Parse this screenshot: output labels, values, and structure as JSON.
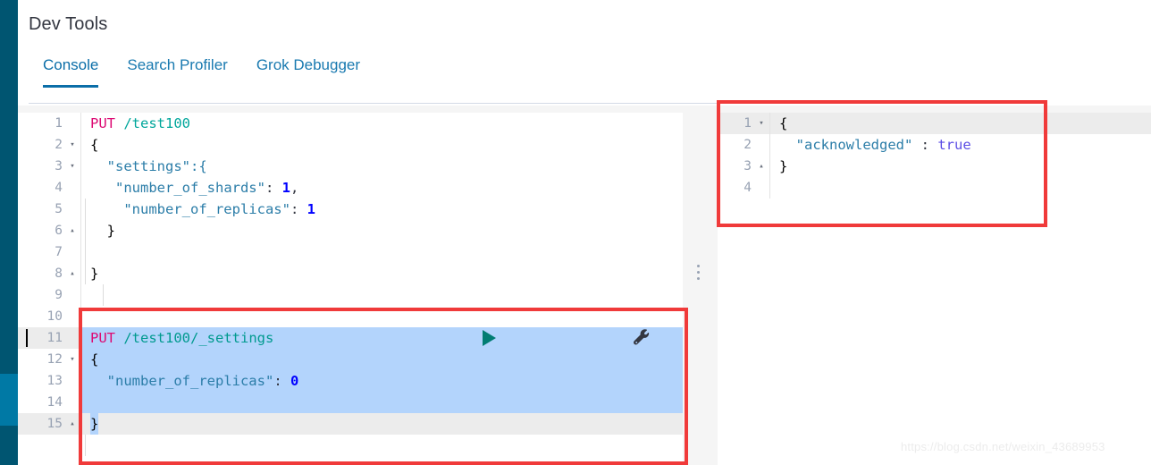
{
  "nav": {
    "rail_color": "#005571",
    "active_color": "#0079a5",
    "active_item_name": "dev-tools"
  },
  "header": {
    "title": "Dev Tools"
  },
  "tabs": [
    {
      "label": "Console",
      "name": "tab-console",
      "active": true
    },
    {
      "label": "Search Profiler",
      "name": "tab-search-profiler",
      "active": false
    },
    {
      "label": "Grok Debugger",
      "name": "tab-grok-debugger",
      "active": false
    }
  ],
  "request_editor": {
    "lines": [
      {
        "number": "1",
        "fold": "",
        "state": "none"
      },
      {
        "number": "2",
        "fold": "▾",
        "state": "none"
      },
      {
        "number": "3",
        "fold": "▾",
        "state": "none"
      },
      {
        "number": "4",
        "fold": "",
        "state": "none"
      },
      {
        "number": "5",
        "fold": "",
        "state": "none"
      },
      {
        "number": "6",
        "fold": "▴",
        "state": "none"
      },
      {
        "number": "7",
        "fold": "",
        "state": "none"
      },
      {
        "number": "8",
        "fold": "▴",
        "state": "none"
      },
      {
        "number": "9",
        "fold": "",
        "state": "none"
      },
      {
        "number": "10",
        "fold": "",
        "state": "none"
      },
      {
        "number": "11",
        "fold": "",
        "state": "selected"
      },
      {
        "number": "12",
        "fold": "▾",
        "state": "selected"
      },
      {
        "number": "13",
        "fold": "",
        "state": "selected"
      },
      {
        "number": "14",
        "fold": "",
        "state": "selected"
      },
      {
        "number": "15",
        "fold": "▴",
        "state": "current"
      }
    ],
    "line1_method": "PUT",
    "line1_url": "/test100",
    "line2_text": "{",
    "line3_text": "\"settings\":{",
    "line4_key": "\"number_of_shards\"",
    "line4_sep": ": ",
    "line4_value": "1",
    "line4_comma": ",",
    "line5_key": "\"number_of_replicas\"",
    "line5_sep": ": ",
    "line5_value": "1",
    "line6_text": "}",
    "line7_text": "",
    "line8_text": "}",
    "line9_text": "",
    "line10_text": "",
    "line11_method": "PUT",
    "line11_url": "/test100/_settings",
    "line12_text": "{",
    "line13_key": "\"number_of_replicas\"",
    "line13_sep": ": ",
    "line13_value": "0",
    "line14_text": "",
    "line15_text": "}"
  },
  "request_actions": {
    "play_name": "send-request-play-button",
    "play_color": "#017d73",
    "wrench_name": "request-options-wrench-button",
    "wrench_color": "#343741"
  },
  "response_editor": {
    "lines": [
      {
        "number": "1",
        "fold": "▾",
        "state": "current"
      },
      {
        "number": "2",
        "fold": "",
        "state": "none"
      },
      {
        "number": "3",
        "fold": "▴",
        "state": "none"
      },
      {
        "number": "4",
        "fold": "",
        "state": "none"
      }
    ],
    "line1_text": "{",
    "line2_key": "\"acknowledged\"",
    "line2_sep": " : ",
    "line2_value": "true",
    "line3_text": "}",
    "line4_text": ""
  },
  "annotations": {
    "color": "#f03a3a",
    "request_box_name": "annotation-box-request",
    "response_box_name": "annotation-box-response"
  },
  "splitter": {
    "name": "pane-splitter",
    "handle_glyph": "⋮"
  },
  "watermark": {
    "text": "https://blog.csdn.net/weixin_43689953"
  }
}
